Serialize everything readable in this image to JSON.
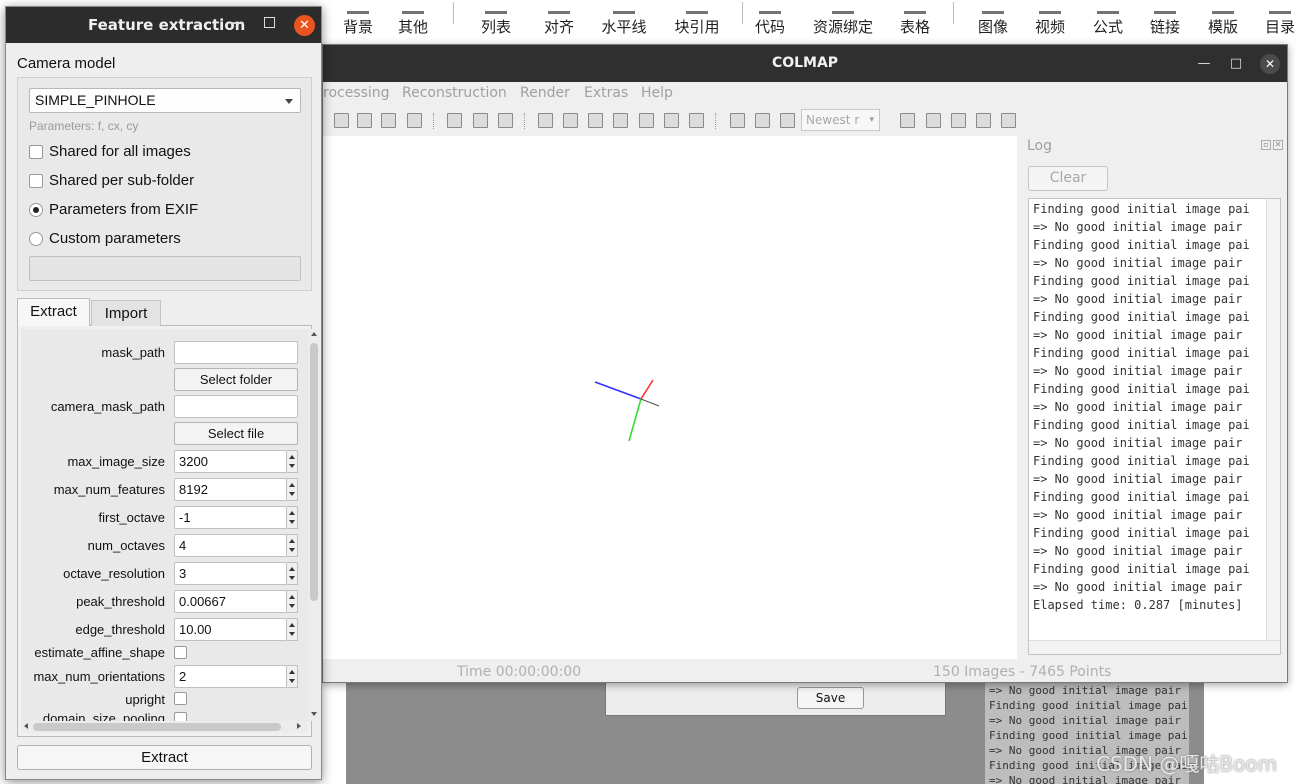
{
  "top_toolbar": {
    "items": [
      "背景",
      "其他",
      "列表",
      "对齐",
      "水平线",
      "块引用",
      "代码",
      "资源绑定",
      "表格",
      "图像",
      "视频",
      "公式",
      "链接",
      "模版",
      "目录"
    ]
  },
  "colmap": {
    "title": "COLMAP",
    "menu": [
      "rocessing",
      "Reconstruction",
      "Render",
      "Extras",
      "Help"
    ],
    "newest_dropdown": "Newest r",
    "status_time": "Time 00:00:00:00",
    "status_counts": "150 Images - 7465 Points",
    "log": {
      "title": "Log",
      "clear_label": "Clear",
      "lines": [
        "Finding good initial image pai",
        "=> No good initial image pair",
        "Finding good initial image pai",
        "=> No good initial image pair",
        "Finding good initial image pai",
        "=> No good initial image pair",
        "Finding good initial image pai",
        "=> No good initial image pair",
        "Finding good initial image pai",
        "=> No good initial image pair",
        "Finding good initial image pai",
        "=> No good initial image pair",
        "Finding good initial image pai",
        "=> No good initial image pair",
        "Finding good initial image pai",
        "=> No good initial image pair",
        "Finding good initial image pai",
        "=> No good initial image pair",
        "Finding good initial image pai",
        "=> No good initial image pair",
        "Finding good initial image pai",
        "=> No good initial image pair",
        "Elapsed time: 0.287 [minutes]"
      ]
    }
  },
  "background": {
    "save_label": "Save",
    "log_lines": [
      "=> No good initial image pair",
      "Finding good initial image pai",
      "=> No good initial image pair",
      "Finding good initial image pai",
      "=> No good initial image pair",
      "Finding good initial image pai",
      "=> No good initial image pair"
    ],
    "watermark": "CSDN @嘎咕Boom"
  },
  "feature_extraction": {
    "title": "Feature extraction",
    "camera_model_label": "Camera model",
    "camera_model_value": "SIMPLE_PINHOLE",
    "parameters_hint": "Parameters: f, cx, cy",
    "shared_all": "Shared for all images",
    "shared_subfolder": "Shared per sub-folder",
    "params_exif": "Parameters from EXIF",
    "custom_params": "Custom parameters",
    "tabs": {
      "extract": "Extract",
      "import": "Import"
    },
    "fields": {
      "mask_path": "mask_path",
      "select_folder": "Select folder",
      "camera_mask_path": "camera_mask_path",
      "select_file": "Select file",
      "max_image_size": {
        "label": "max_image_size",
        "value": "3200"
      },
      "max_num_features": {
        "label": "max_num_features",
        "value": "8192"
      },
      "first_octave": {
        "label": "first_octave",
        "value": "-1"
      },
      "num_octaves": {
        "label": "num_octaves",
        "value": "4"
      },
      "octave_resolution": {
        "label": "octave_resolution",
        "value": "3"
      },
      "peak_threshold": {
        "label": "peak_threshold",
        "value": "0.00667"
      },
      "edge_threshold": {
        "label": "edge_threshold",
        "value": "10.00"
      },
      "estimate_affine_shape": "estimate_affine_shape",
      "max_num_orientations": {
        "label": "max_num_orientations",
        "value": "2"
      },
      "upright": "upright",
      "domain_size_pooling": "domain_size_pooling"
    },
    "extract_button": "Extract"
  },
  "colors": {
    "ubuntu_close": "#e95420",
    "title_bar": "#2c2c2c",
    "axis_x": "#ff3333",
    "axis_y": "#33dd33",
    "axis_z": "#3333ff"
  }
}
